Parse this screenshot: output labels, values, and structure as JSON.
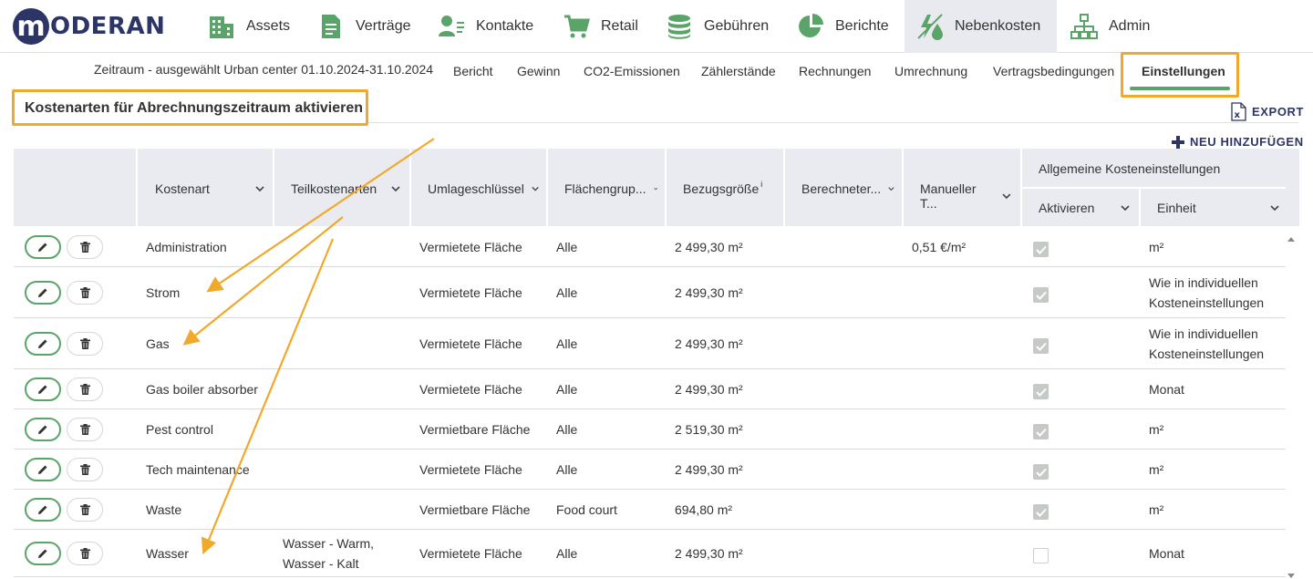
{
  "app": {
    "logo_initial": "m",
    "logo_text": "ODERAN"
  },
  "nav": [
    {
      "label": "Assets",
      "icon": "building-icon"
    },
    {
      "label": "Verträge",
      "icon": "document-icon"
    },
    {
      "label": "Kontakte",
      "icon": "contacts-icon"
    },
    {
      "label": "Retail",
      "icon": "cart-icon"
    },
    {
      "label": "Gebühren",
      "icon": "coins-icon"
    },
    {
      "label": "Berichte",
      "icon": "pie-chart-icon"
    },
    {
      "label": "Nebenkosten",
      "icon": "utilities-icon",
      "active": true
    },
    {
      "label": "Admin",
      "icon": "org-chart-icon"
    }
  ],
  "subnav": {
    "period": "Zeitraum - ausgewählt Urban center 01.10.2024-31.10.2024",
    "tabs": [
      "Bericht",
      "Gewinn",
      "CO2-Emissionen",
      "Zählerstände",
      "Rechnungen",
      "Umrechnung",
      "Vertragsbedingungen",
      "Einstellungen"
    ],
    "active_tab": "Einstellungen"
  },
  "section": {
    "title": "Kostenarten für Abrechnungszeitraum aktivieren",
    "export_label": "EXPORT",
    "add_label": "NEU HINZUFÜGEN"
  },
  "table": {
    "headers": {
      "kostenart": "Kostenart",
      "teilkostenarten": "Teilkostenarten",
      "umlageschluessel": "Umlageschlüssel",
      "flaechengruppe": "Flächengrup...",
      "bezugsgroesse": "Bezugsgröße",
      "bezugsgroesse_sup": "i",
      "berechneter": "Berechneter...",
      "manueller": "Manueller T...",
      "allgemeine": "Allgemeine Kosteneinstellungen",
      "aktivieren": "Aktivieren",
      "einheit": "Einheit"
    },
    "rows": [
      {
        "kostenart": "Administration",
        "teil": "",
        "umlage": "Vermietete Fläche",
        "flaeche": "Alle",
        "bezug": "2 499,30 m²",
        "berechnet": "",
        "manuell": "0,51 €/m²",
        "aktiv": true,
        "einheit": "m²"
      },
      {
        "kostenart": "Strom",
        "teil": "",
        "umlage": "Vermietete Fläche",
        "flaeche": "Alle",
        "bezug": "2 499,30 m²",
        "berechnet": "",
        "manuell": "",
        "aktiv": true,
        "einheit": "Wie in individuellen Kosteneinstellungen"
      },
      {
        "kostenart": "Gas",
        "teil": "",
        "umlage": "Vermietete Fläche",
        "flaeche": "Alle",
        "bezug": "2 499,30 m²",
        "berechnet": "",
        "manuell": "",
        "aktiv": true,
        "einheit": "Wie in individuellen Kosteneinstellungen"
      },
      {
        "kostenart": "Gas boiler absorber",
        "teil": "",
        "umlage": "Vermietete Fläche",
        "flaeche": "Alle",
        "bezug": "2 499,30 m²",
        "berechnet": "",
        "manuell": "",
        "aktiv": true,
        "einheit": "Monat"
      },
      {
        "kostenart": "Pest control",
        "teil": "",
        "umlage": "Vermietbare Fläche",
        "flaeche": "Alle",
        "bezug": "2 519,30 m²",
        "berechnet": "",
        "manuell": "",
        "aktiv": true,
        "einheit": "m²"
      },
      {
        "kostenart": "Tech maintenance",
        "teil": "",
        "umlage": "Vermietete Fläche",
        "flaeche": "Alle",
        "bezug": "2 499,30 m²",
        "berechnet": "",
        "manuell": "",
        "aktiv": true,
        "einheit": "m²"
      },
      {
        "kostenart": "Waste",
        "teil": "",
        "umlage": "Vermietbare Fläche",
        "flaeche": "Food court",
        "bezug": "694,80 m²",
        "berechnet": "",
        "manuell": "",
        "aktiv": true,
        "einheit": "m²"
      },
      {
        "kostenart": "Wasser",
        "teil": "Wasser - Warm, Wasser - Kalt",
        "umlage": "Vermietete Fläche",
        "flaeche": "Alle",
        "bezug": "2 499,30 m²",
        "berechnet": "",
        "manuell": "",
        "aktiv": false,
        "einheit": "Monat"
      }
    ]
  },
  "colors": {
    "brand": "#2c3566",
    "accent_green": "#5aa469",
    "highlight": "#f0a92a",
    "header_bg": "#e9ebf0"
  }
}
